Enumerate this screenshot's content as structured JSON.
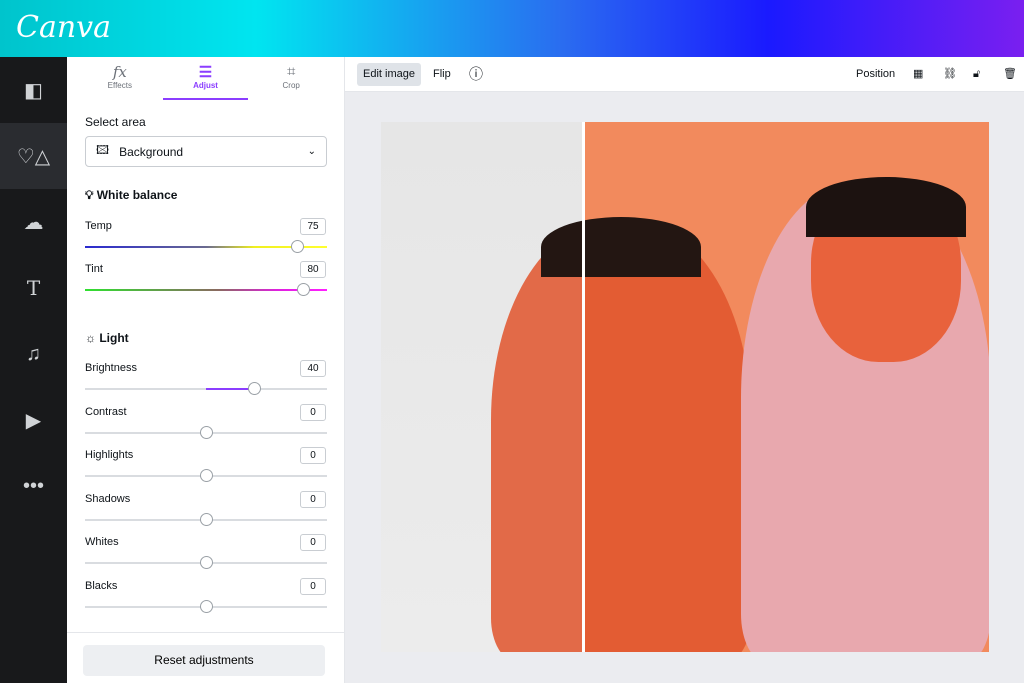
{
  "app": {
    "logo": "Canva"
  },
  "rail": {
    "items": [
      {
        "icon": "layout-icon"
      },
      {
        "icon": "elements-icon"
      },
      {
        "icon": "upload-icon"
      },
      {
        "icon": "text-icon"
      },
      {
        "icon": "music-icon"
      },
      {
        "icon": "video-icon"
      },
      {
        "icon": "more-icon"
      }
    ]
  },
  "panel": {
    "tabs": [
      {
        "label": "Effects",
        "icon": "fx"
      },
      {
        "label": "Adjust",
        "icon": "≡"
      },
      {
        "label": "Crop",
        "icon": "⌗"
      }
    ],
    "select_area_label": "Select area",
    "select_value": "Background",
    "white_balance": "White balance",
    "light": "Light",
    "sliders": [
      {
        "label": "Temp",
        "value": 75,
        "gradient": "temp"
      },
      {
        "label": "Tint",
        "value": 80,
        "gradient": "tint"
      },
      {
        "label": "Brightness",
        "value": 40
      },
      {
        "label": "Contrast",
        "value": 0
      },
      {
        "label": "Highlights",
        "value": 0
      },
      {
        "label": "Shadows",
        "value": 0
      },
      {
        "label": "Whites",
        "value": 0
      },
      {
        "label": "Blacks",
        "value": 0
      }
    ],
    "reset": "Reset adjustments"
  },
  "toolbar": {
    "edit_image": "Edit image",
    "flip": "Flip",
    "position": "Position"
  },
  "colors": {
    "accent": "#8b3dff",
    "rail": "#18191b"
  }
}
